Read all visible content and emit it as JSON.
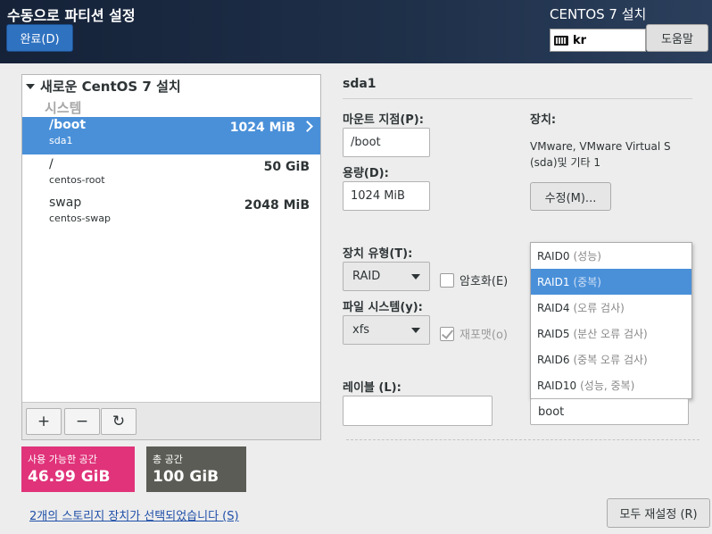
{
  "header": {
    "title": "수동으로 파티션 설정",
    "done_label": "완료(D)",
    "product": "CENTOS 7 설치",
    "keyboard_layout": "kr",
    "help_label": "도움말"
  },
  "tree": {
    "root_label": "새로운 CentOS 7 설치",
    "group_label": "시스템",
    "partitions": [
      {
        "name": "/boot",
        "device": "sda1",
        "size": "1024 MiB",
        "selected": true
      },
      {
        "name": "/",
        "device": "centos-root",
        "size": "50 GiB",
        "selected": false
      },
      {
        "name": "swap",
        "device": "centos-swap",
        "size": "2048 MiB",
        "selected": false
      }
    ],
    "toolbar": {
      "add": "+",
      "remove": "−",
      "refresh": "↻"
    }
  },
  "space": {
    "available_label": "사용 가능한 공간",
    "available_value": "46.99 GiB",
    "total_label": "총 공간",
    "total_value": "100 GiB"
  },
  "storage_link": "2개의 스토리지 장치가 선택되었습니다 (S)",
  "detail": {
    "device_title": "sda1",
    "mount_label": "마운트 지점(P):",
    "mount_value": "/boot",
    "capacity_label": "용량(D):",
    "capacity_value": "1024 MiB",
    "devices_label": "장치:",
    "devices_text_1": "VMware, VMware Virtual S",
    "devices_text_2": "(sda)및 기타 1",
    "modify_label": "수정(M)...",
    "device_type_label": "장치 유형(T):",
    "device_type_value": "RAID",
    "encrypt_label": "암호화(E)",
    "fs_label": "파일 시스템(y):",
    "fs_value": "xfs",
    "reformat_label": "재포맷(o)",
    "label_label": "레이블 (L):",
    "label_value": "",
    "name_value": "boot",
    "raid_levels": [
      {
        "level": "RAID0",
        "desc": "(성능)",
        "selected": false
      },
      {
        "level": "RAID1",
        "desc": "(중복)",
        "selected": true
      },
      {
        "level": "RAID4",
        "desc": "(오류 검사)",
        "selected": false
      },
      {
        "level": "RAID5",
        "desc": "(분산 오류 검사)",
        "selected": false
      },
      {
        "level": "RAID6",
        "desc": "(중복 오류 검사)",
        "selected": false
      },
      {
        "level": "RAID10",
        "desc": "(성능, 중복)",
        "selected": false
      }
    ]
  },
  "reset_label": "모두 재설정 (R)",
  "colors": {
    "selection": "#4a90d9",
    "available_bg": "#e0337a",
    "total_bg": "#5c5c56",
    "header_bg": "#1a2a40"
  }
}
